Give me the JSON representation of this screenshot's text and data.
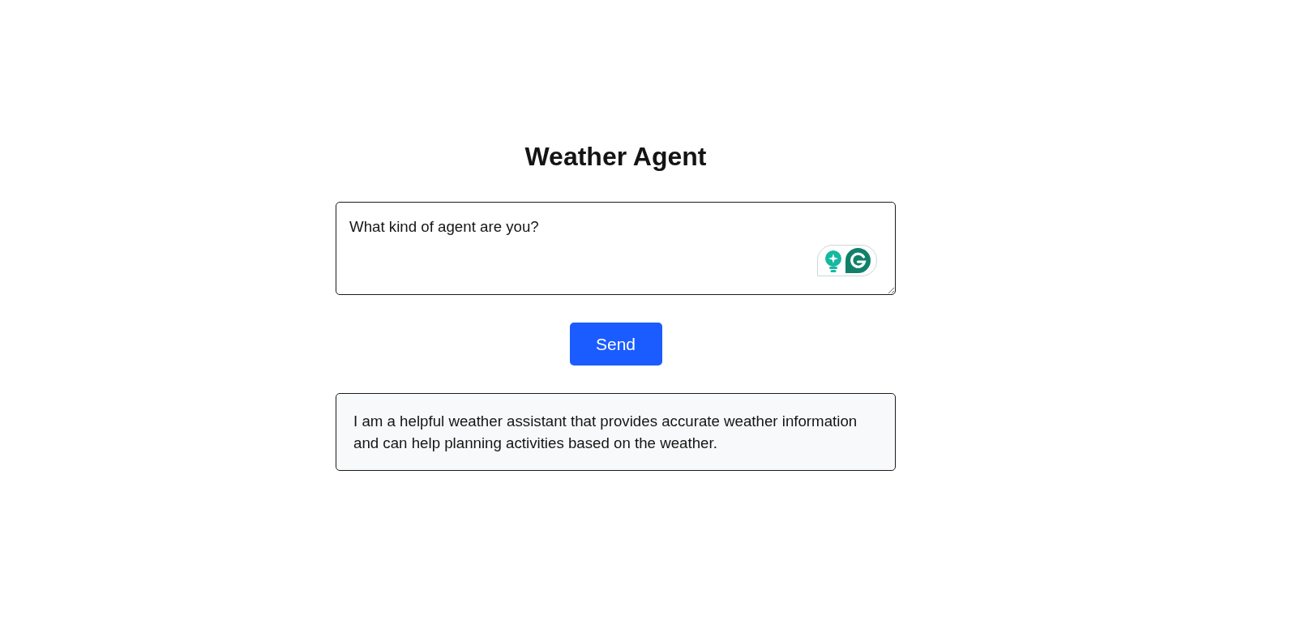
{
  "page": {
    "title": "Weather Agent"
  },
  "prompt": {
    "value": "What kind of agent are you?"
  },
  "send_button": {
    "label": "Send"
  },
  "response": {
    "text": "I am a helpful weather assistant that provides accurate weather information and can help planning activities based on the weather."
  }
}
